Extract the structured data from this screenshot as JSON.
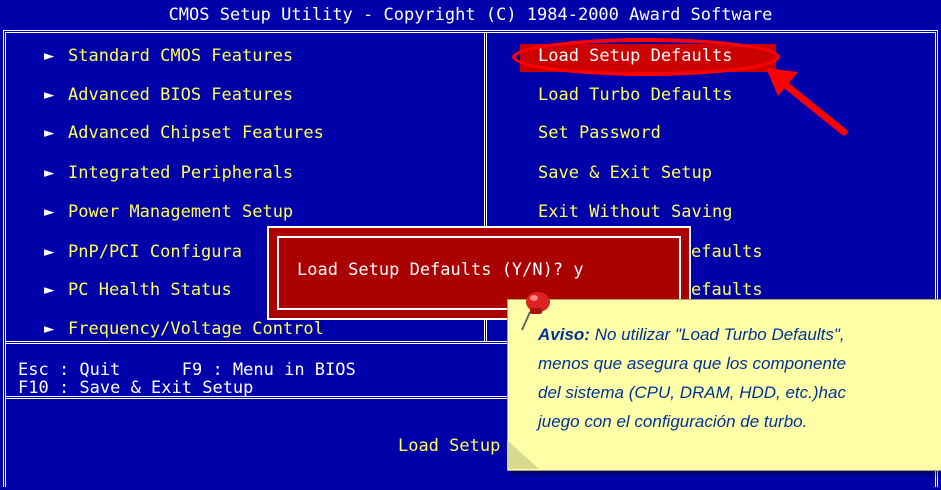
{
  "window": {
    "title": "CMOS Setup Utility - Copyright (C) 1984-2000 Award Software"
  },
  "left_menu": [
    {
      "label": "Standard CMOS Features"
    },
    {
      "label": "Advanced BIOS Features"
    },
    {
      "label": "Advanced Chipset Features"
    },
    {
      "label": "Integrated Peripherals"
    },
    {
      "label": "Power Management Setup"
    },
    {
      "label": "PnP/PCI Configura"
    },
    {
      "label": "PC Health Status"
    },
    {
      "label": "Frequency/Voltage Control"
    }
  ],
  "right_menu": [
    {
      "label": "Load Setup Defaults"
    },
    {
      "label": "Load Turbo Defaults"
    },
    {
      "label": "Set Password"
    },
    {
      "label": "Save & Exit Setup"
    },
    {
      "label": "Exit Without Saving"
    },
    {
      "label": "efaults"
    },
    {
      "label": "efaults"
    }
  ],
  "help": {
    "line1": "Esc : Quit      F9 : Menu in BIOS",
    "line2": "F10 : Save & Exit Setup"
  },
  "status": {
    "text": "Load Setup De"
  },
  "dialog": {
    "text": "Load Setup Defaults (Y/N)? y"
  },
  "note": {
    "label": "Aviso:",
    "line1": "No utilizar \"Load Turbo Defaults\",",
    "line2": "menos que asegura que los componente",
    "line3": "del sistema (CPU, DRAM, HDD, etc.)hac",
    "line4": "juego con el configuración de turbo."
  },
  "colors": {
    "background": "#0000aa",
    "menu_text": "#ffff55",
    "highlight": "#cc0000",
    "dialog": "#aa0000",
    "note": "#ffffa8"
  }
}
